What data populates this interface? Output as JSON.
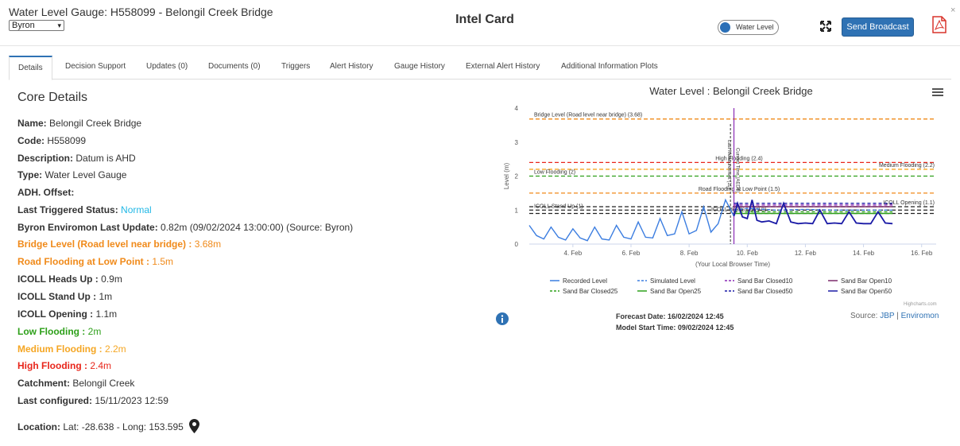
{
  "header": {
    "title": "Water Level Gauge: H558099 - Belongil Creek Bridge",
    "region_select": "Byron",
    "card_title": "Intel Card",
    "toggle_label": "Water Level",
    "broadcast_label": "Send Broadcast",
    "close_label": "×"
  },
  "tabs": [
    {
      "label": "Details",
      "active": true
    },
    {
      "label": "Decision Support"
    },
    {
      "label": "Updates (0)"
    },
    {
      "label": "Documents (0)"
    },
    {
      "label": "Triggers"
    },
    {
      "label": "Alert History"
    },
    {
      "label": "Gauge History"
    },
    {
      "label": "External Alert History"
    },
    {
      "label": "Additional Information Plots"
    }
  ],
  "details": {
    "heading": "Core Details",
    "name_k": "Name:",
    "name_v": "Belongil Creek Bridge",
    "code_k": "Code:",
    "code_v": "H558099",
    "desc_k": "Description:",
    "desc_v": "Datum is AHD",
    "type_k": "Type:",
    "type_v": "Water Level Gauge",
    "adh_k": "ADH. Offset:",
    "trig_k": "Last Triggered Status:",
    "trig_v": "Normal",
    "upd_k": "Byron Enviromon Last Update:",
    "upd_v": "0.82m (09/02/2024 13:00:00) (Source: Byron)",
    "bridge_k": "Bridge Level (Road level near bridge) :",
    "bridge_v": "3.68m",
    "road_k": "Road Flooding at Low Point :",
    "road_v": "1.5m",
    "heads_k": "ICOLL Heads Up :",
    "heads_v": "0.9m",
    "stand_k": "ICOLL Stand Up :",
    "stand_v": "1m",
    "open_k": "ICOLL Opening :",
    "open_v": "1.1m",
    "low_k": "Low Flooding :",
    "low_v": "2m",
    "med_k": "Medium Flooding :",
    "med_v": "2.2m",
    "high_k": "High Flooding :",
    "high_v": "2.4m",
    "catch_k": "Catchment:",
    "catch_v": "Belongil Creek",
    "conf_k": "Last configured:",
    "conf_v": "15/11/2023 12:59",
    "loc_k": "Location:",
    "loc_v": "Lat: -28.638 - Long: 153.595"
  },
  "colors": {
    "accent": "#2f72b4",
    "orange": "#f08a1a",
    "green": "#2ea01a",
    "amber": "#f5a623",
    "red": "#e8261b",
    "cyan": "#22b8e6"
  },
  "chart_data": {
    "type": "line",
    "title": "Water Level : Belongil Creek Bridge",
    "xlabel": "(Your Local Browser Time)",
    "ylabel": "Level (m)",
    "x_ticks": [
      "4. Feb",
      "6. Feb",
      "8. Feb",
      "10. Feb",
      "12. Feb",
      "14. Feb",
      "16. Feb"
    ],
    "y_ticks": [
      "0",
      "1",
      "2",
      "3",
      "4"
    ],
    "xlim": [
      "2024-02-02 12:00",
      "2024-02-16 12:00"
    ],
    "ylim": [
      0,
      4
    ],
    "thresholds": [
      {
        "label": "Bridge Level (Road level near bridge) (3.68)",
        "value": 3.68,
        "color": "#f08a1a"
      },
      {
        "label": "High Flooding (2.4)",
        "value": 2.4,
        "color": "#e8261b"
      },
      {
        "label": "Medium Flooding (2.2)",
        "value": 2.2,
        "color": "#f5a623"
      },
      {
        "label": "Low Flooding (2)",
        "value": 2.0,
        "color": "#2ea01a"
      },
      {
        "label": "Road Flooding at Low Point (1.5)",
        "value": 1.5,
        "color": "#f08a1a"
      },
      {
        "label": "ICOLL Opening (1.1)",
        "value": 1.1,
        "color": "#222222"
      },
      {
        "label": "ICOLL Stand Up (1)",
        "value": 1.0,
        "color": "#222222"
      },
      {
        "label": "ICOLL Heads Up (0.9)",
        "value": 0.9,
        "color": "#222222"
      }
    ],
    "current_time": {
      "label": "Last Measurement (11)",
      "x": "2024-02-09 13:00"
    },
    "forecast_start": {
      "label": "Current Time (AEDT)",
      "x": "2024-02-09 12:45"
    },
    "series": [
      {
        "name": "Recorded Level",
        "color": "#3b7de0",
        "dash": "solid",
        "x": [
          "2024-02-02 12:00",
          "2024-02-02 18:00",
          "2024-02-03 00:00",
          "2024-02-03 06:00",
          "2024-02-03 12:00",
          "2024-02-03 18:00",
          "2024-02-04 00:00",
          "2024-02-04 06:00",
          "2024-02-04 12:00",
          "2024-02-04 18:00",
          "2024-02-05 00:00",
          "2024-02-05 06:00",
          "2024-02-05 12:00",
          "2024-02-05 18:00",
          "2024-02-06 00:00",
          "2024-02-06 06:00",
          "2024-02-06 12:00",
          "2024-02-06 18:00",
          "2024-02-07 00:00",
          "2024-02-07 06:00",
          "2024-02-07 12:00",
          "2024-02-07 18:00",
          "2024-02-08 00:00",
          "2024-02-08 06:00",
          "2024-02-08 12:00",
          "2024-02-08 18:00",
          "2024-02-09 00:00",
          "2024-02-09 06:00",
          "2024-02-09 13:00"
        ],
        "values": [
          0.55,
          0.25,
          0.15,
          0.5,
          0.2,
          0.12,
          0.45,
          0.18,
          0.1,
          0.5,
          0.15,
          0.12,
          0.55,
          0.2,
          0.15,
          0.65,
          0.2,
          0.18,
          0.75,
          0.25,
          0.3,
          0.95,
          0.3,
          0.4,
          1.1,
          0.35,
          0.6,
          1.3,
          0.82
        ]
      },
      {
        "name": "Simulated Level",
        "color": "#3b7de0",
        "dash": "dashed",
        "x": [
          "2024-02-09 13:00",
          "2024-02-10 00:00",
          "2024-02-11 00:00",
          "2024-02-12 00:00",
          "2024-02-13 00:00",
          "2024-02-14 00:00",
          "2024-02-15 00:00"
        ],
        "values": [
          1.0,
          1.05,
          1.0,
          1.02,
          1.0,
          1.0,
          1.0
        ]
      },
      {
        "name": "Sand Bar Closed10",
        "color": "#8a2bb5",
        "dash": "dashed",
        "x": [
          "2024-02-09 13:00",
          "2024-02-15 00:00"
        ],
        "values": [
          1.15,
          1.15
        ]
      },
      {
        "name": "Sand Bar Open10",
        "color": "#7a2a6a",
        "dash": "solid",
        "x": [
          "2024-02-09 13:00",
          "2024-02-15 00:00"
        ],
        "values": [
          1.1,
          1.1
        ]
      },
      {
        "name": "Sand Bar Closed25",
        "color": "#2ea01a",
        "dash": "dashed",
        "x": [
          "2024-02-09 13:00",
          "2024-02-15 00:00"
        ],
        "values": [
          0.95,
          0.95
        ]
      },
      {
        "name": "Sand Bar Open25",
        "color": "#2ea01a",
        "dash": "solid",
        "x": [
          "2024-02-09 13:00",
          "2024-02-15 00:00"
        ],
        "values": [
          0.9,
          0.9
        ]
      },
      {
        "name": "Sand Bar Closed50",
        "color": "#1a1aa6",
        "dash": "dashed",
        "x": [
          "2024-02-09 13:00",
          "2024-02-15 00:00"
        ],
        "values": [
          1.2,
          1.2
        ]
      },
      {
        "name": "Sand Bar Open50",
        "color": "#1a1aa6",
        "dash": "solid",
        "x": [
          "2024-02-09 13:00",
          "2024-02-09 16:00",
          "2024-02-09 20:00",
          "2024-02-10 00:00",
          "2024-02-10 04:00",
          "2024-02-10 08:00",
          "2024-02-10 12:00",
          "2024-02-10 18:00",
          "2024-02-11 00:00",
          "2024-02-11 06:00",
          "2024-02-11 12:00",
          "2024-02-11 18:00",
          "2024-02-12 00:00",
          "2024-02-12 06:00",
          "2024-02-12 12:00",
          "2024-02-12 18:00",
          "2024-02-13 00:00",
          "2024-02-13 06:00",
          "2024-02-13 12:00",
          "2024-02-13 18:00",
          "2024-02-14 00:00",
          "2024-02-14 06:00",
          "2024-02-14 12:00",
          "2024-02-14 18:00",
          "2024-02-15 00:00"
        ],
        "values": [
          0.82,
          1.2,
          0.8,
          0.75,
          1.3,
          0.7,
          0.65,
          0.68,
          0.6,
          1.2,
          0.65,
          0.6,
          0.62,
          0.6,
          1.0,
          0.6,
          0.62,
          0.6,
          0.95,
          0.62,
          0.6,
          0.6,
          0.95,
          0.62,
          0.6
        ]
      }
    ],
    "legend_position": "bottom",
    "forecast_date": "Forecast Date: 16/02/2024 12:45",
    "model_start": "Model Start Time: 09/02/2024 12:45",
    "source_label": "Source:",
    "source_link1": "JBP",
    "source_sep": "|",
    "source_link2": "Enviromon",
    "credit": "Highcharts.com"
  }
}
